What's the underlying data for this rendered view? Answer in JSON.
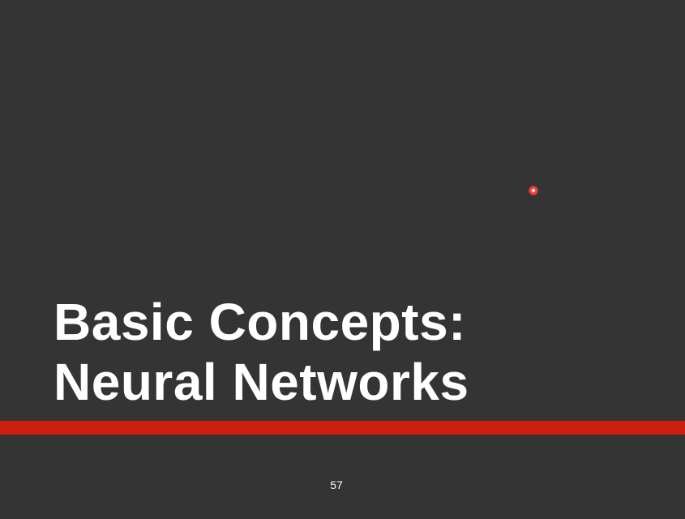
{
  "slide": {
    "title_line1": "Basic Concepts:",
    "title_line2": "Neural Networks",
    "page_number": "57"
  },
  "colors": {
    "background": "#343434",
    "accent_bar": "#cc1f10",
    "text": "#ffffff",
    "pointer": "#ff3a3a"
  }
}
